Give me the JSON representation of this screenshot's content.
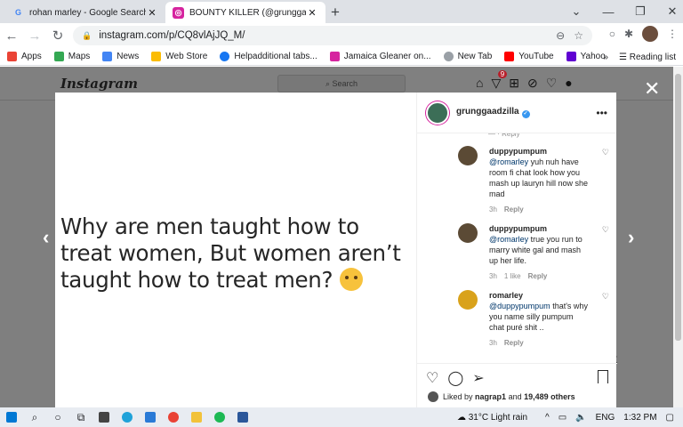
{
  "browser": {
    "tabs": [
      {
        "title": "rohan marley - Google Search",
        "icon": "google-icon",
        "active": false
      },
      {
        "title": "BOUNTY KILLER (@grunggaadzilla",
        "icon": "instagram-icon",
        "active": true
      }
    ],
    "url": "instagram.com/p/CQ8vlAjJQ_M/",
    "bookmarks": [
      "Apps",
      "Maps",
      "News",
      "Web Store",
      "Helpadditional tabs...",
      "Jamaica Gleaner on...",
      "New Tab",
      "YouTube",
      "Yahoo"
    ],
    "more_bookmarks": "»",
    "reading_list": "Reading list"
  },
  "instagram": {
    "logo": "Instagram",
    "search_placeholder": "Search",
    "notification_count": "9",
    "post": {
      "text": "Why are men taught how to treat women, But women aren’t taught how to treat men?",
      "author": "grunggaadzilla",
      "comments": [
        {
          "user": "duppypumpum",
          "mention": "@romarley",
          "text": "yuh nuh have room fi chat look how you mash up lauryn hill now she mad",
          "time": "3h",
          "likes": "",
          "reply": "Reply"
        },
        {
          "user": "duppypumpum",
          "mention": "@romarley",
          "text": "true you run to marry white gal and mash up her life.",
          "time": "3h",
          "likes": "1 like",
          "reply": "Reply"
        },
        {
          "user": "romarley",
          "mention": "@duppypumpum",
          "text": "that's why you name silly pumpum chat puré shit ..",
          "time": "3h",
          "likes": "",
          "reply": "Reply"
        }
      ],
      "liked_by_prefix": "Liked by",
      "liked_by_user": "nagrap1",
      "liked_by_and": "and",
      "liked_by_others": "19,489 others"
    }
  },
  "taskbar": {
    "weather": "31°C  Light rain",
    "lang": "ENG",
    "time": "1:32 PM"
  }
}
